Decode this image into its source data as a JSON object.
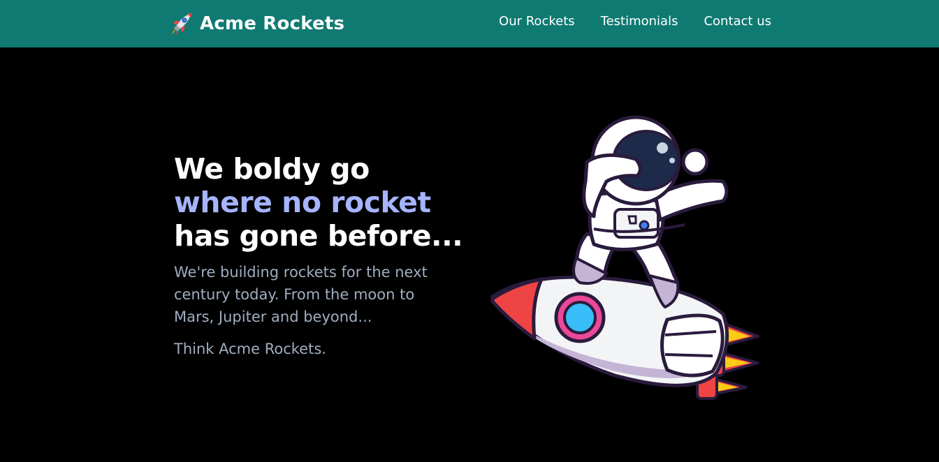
{
  "navbar": {
    "brand_icon": "rocket-icon",
    "brand_text": "Acme Rockets",
    "background": "#0f7a72",
    "links": [
      {
        "label": "Our Rockets"
      },
      {
        "label": "Testimonials"
      },
      {
        "label": "Contact us"
      }
    ]
  },
  "hero": {
    "headline": {
      "line1": "We boldy go",
      "line2": "where no rocket",
      "line3": "has gone before..."
    },
    "accent_color": "#a5b4fc",
    "subtext": "We're building rockets for the next century today. From the moon to Mars, Jupiter and beyond...",
    "tagline": "Think Acme Rockets.",
    "illustration": "astronaut-on-rocket-illustration"
  }
}
